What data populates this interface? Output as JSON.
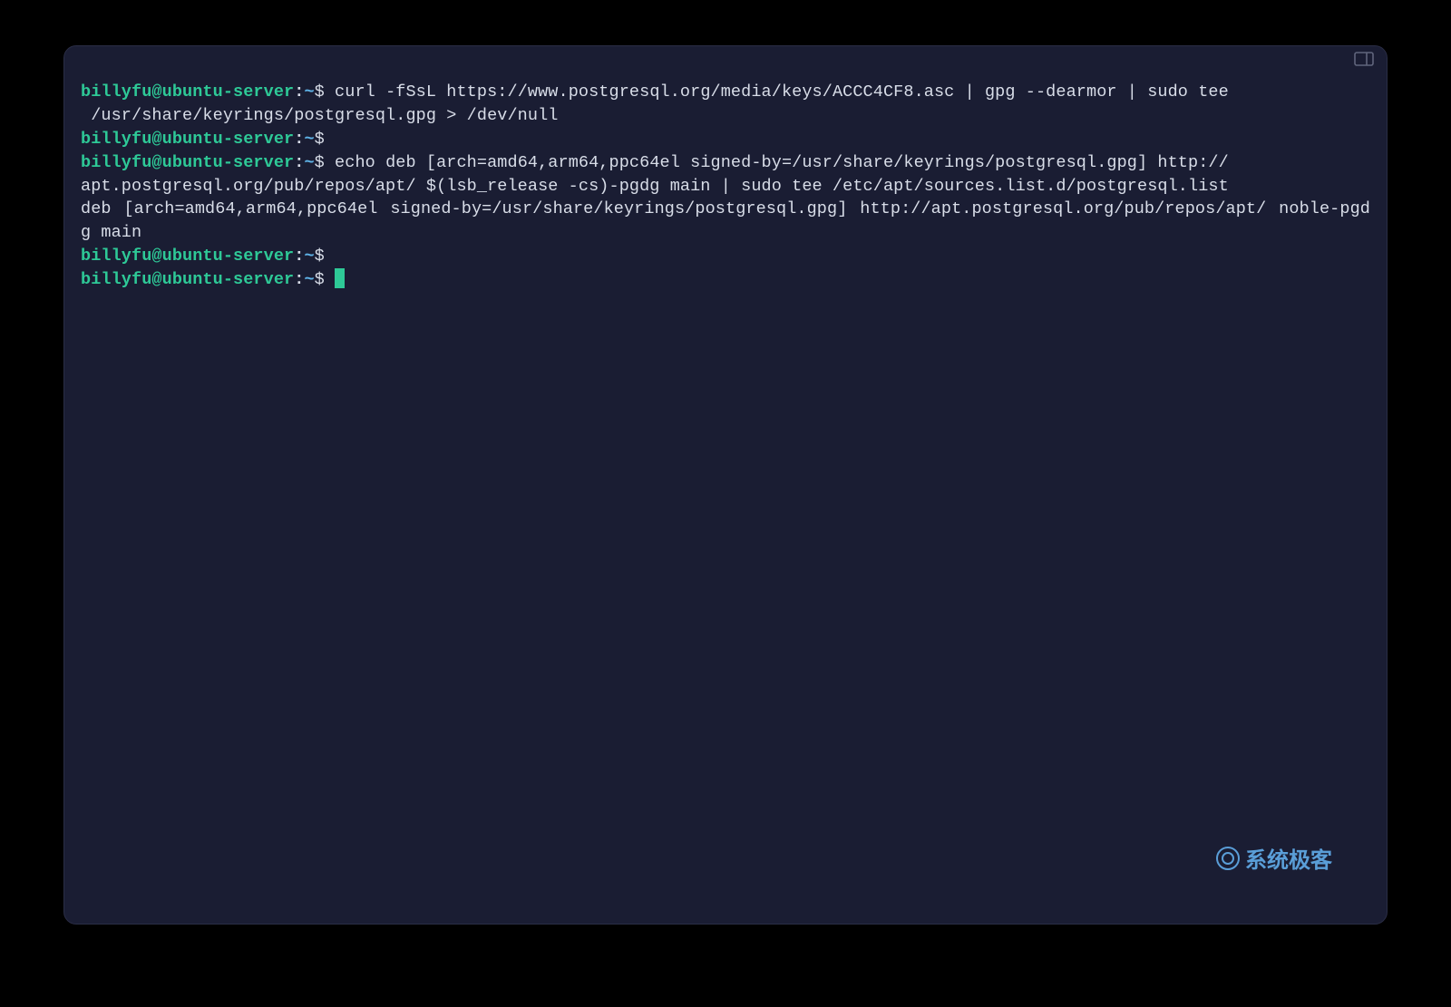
{
  "prompt": {
    "user_host": "billyfu@ubuntu-server",
    "colon": ":",
    "path": "~",
    "dollar": "$"
  },
  "lines": {
    "l1_cmd": " curl -fSsL https://www.postgresql.org/media/keys/ACCC4CF8.asc | gpg --dearmor | sudo tee",
    "l2_cmd": " /usr/share/keyrings/postgresql.gpg > /dev/null",
    "l4_cmd": " echo deb [arch=amd64,arm64,ppc64el signed-by=/usr/share/keyrings/postgresql.gpg] http://",
    "l5_cmd": "apt.postgresql.org/pub/repos/apt/ $(lsb_release -cs)-pgdg main | sudo tee /etc/apt/sources.list.d/postgresql.list",
    "l6_out": "deb [arch=amd64,arm64,ppc64el signed-by=/usr/share/keyrings/postgresql.gpg] http://apt.postgresql.org/pub/repos/apt/ noble-pgdg main"
  },
  "watermark": {
    "text": "系统极客"
  },
  "colors": {
    "bg": "#1a1d33",
    "prompt_user": "#2ec997",
    "prompt_path": "#5fb3e8",
    "text": "#d8dde8",
    "cursor": "#2ec997",
    "watermark": "#5a9ed8"
  }
}
